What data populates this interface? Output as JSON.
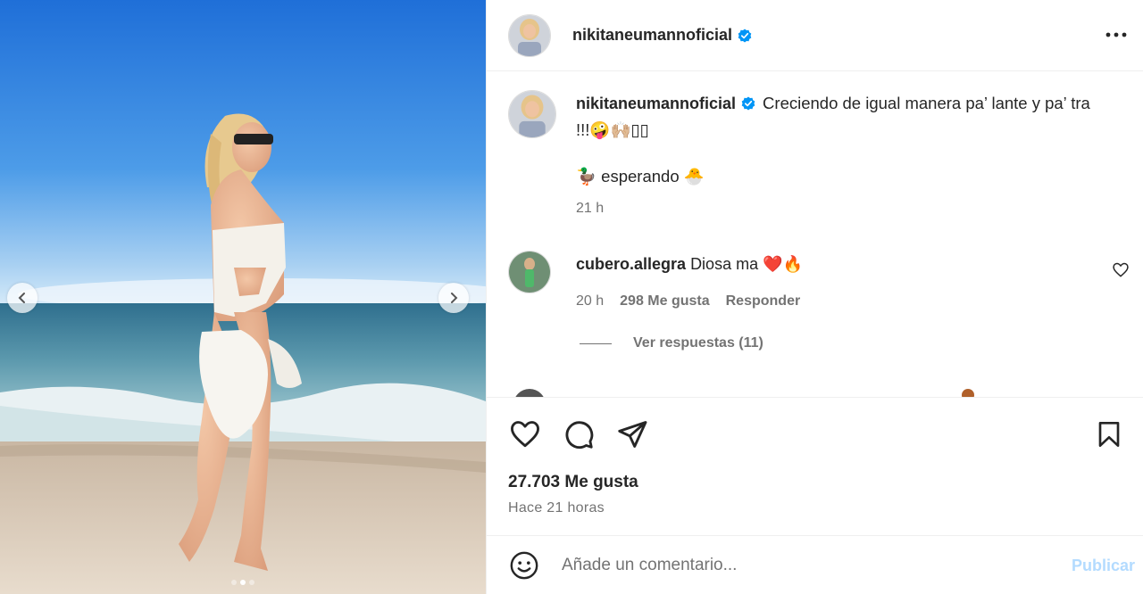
{
  "post": {
    "author": {
      "username": "nikitaneumannoficial",
      "verified": true,
      "avatar_icon": "profile-avatar"
    },
    "caption": {
      "text": "Creciendo de igual manera pa’ lante y pa’ tra !!!🤪🙌🏼▯▯",
      "line2": "🦆 esperando 🐣",
      "time": "21 h"
    },
    "comments": [
      {
        "username": "cubero.allegra",
        "text": "Diosa ma ❤️🔥",
        "time": "20 h",
        "likes": "298 Me gusta",
        "reply_label": "Responder"
      }
    ],
    "view_replies": "Ver respuestas (11)",
    "likes_count": "27.703 Me gusta",
    "posted_ago": "Hace 21 horas",
    "add_comment": {
      "placeholder": "Añade un comentario...",
      "post_label": "Publicar"
    },
    "carousel": {
      "slides": 3,
      "active": 1
    }
  },
  "colors": {
    "verified": "#0095f6",
    "publish_disabled": "#b3dbff",
    "secondary_text": "#737373"
  }
}
